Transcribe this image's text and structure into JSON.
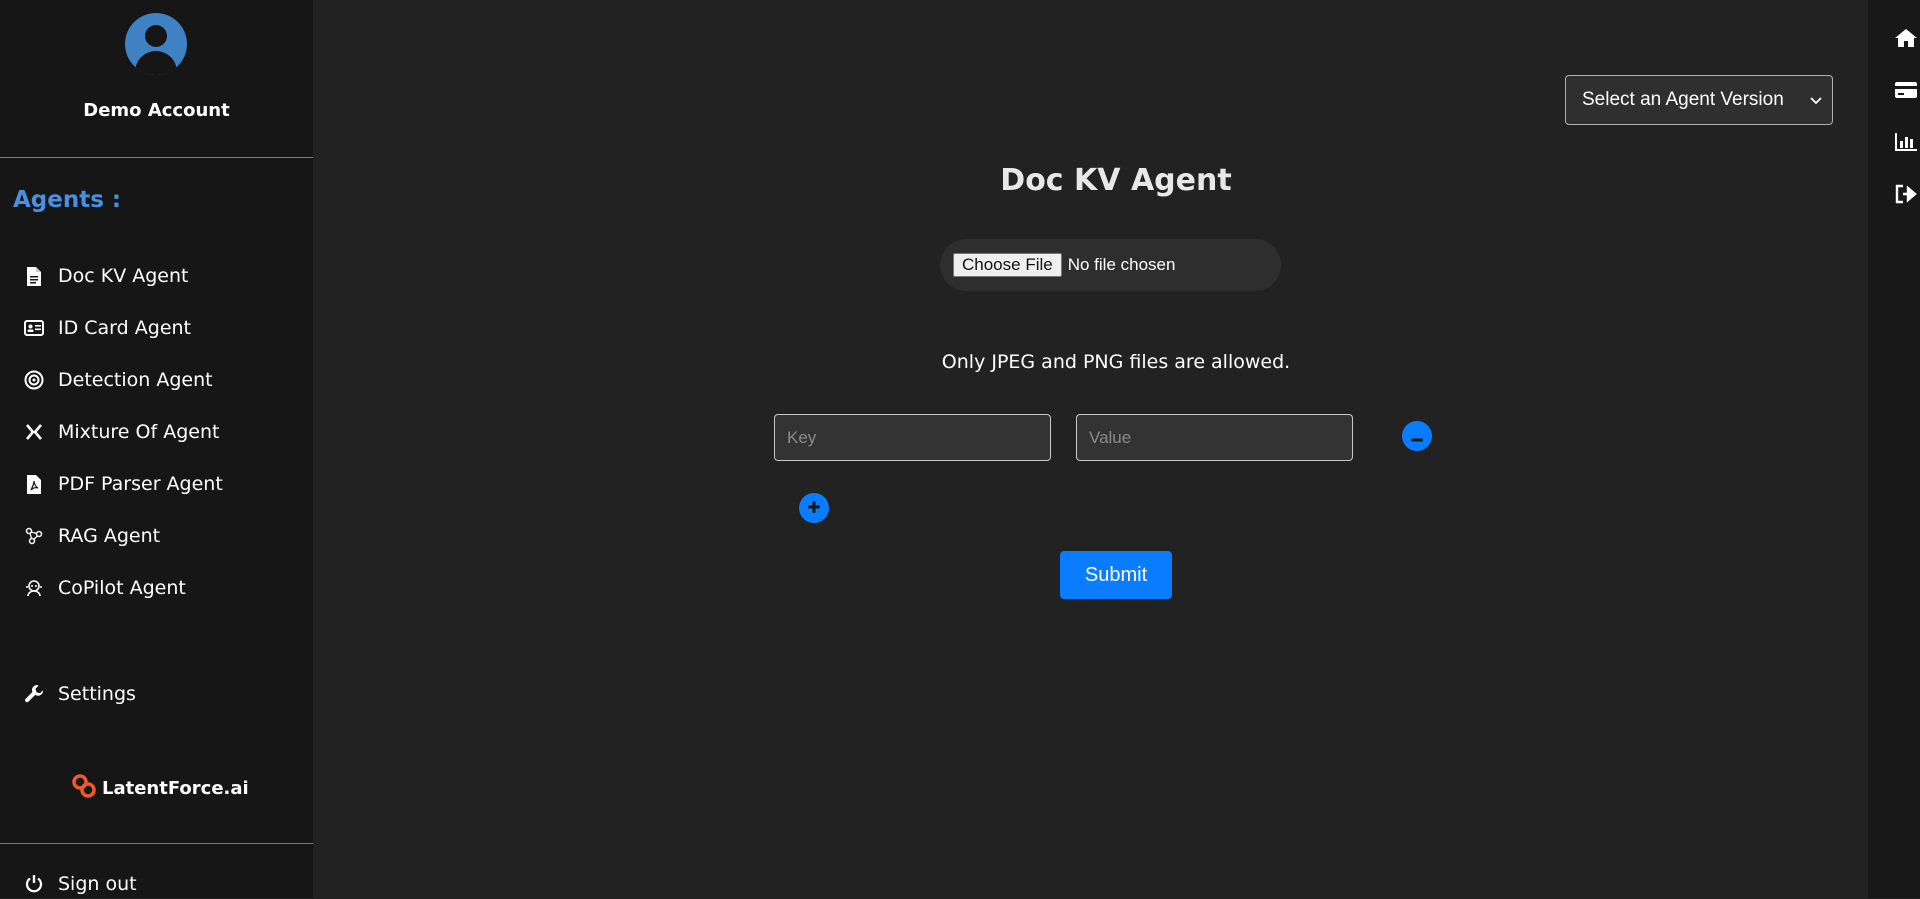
{
  "sidebar": {
    "account_name": "Demo Account",
    "agents_heading": "Agents :",
    "items": [
      {
        "label": "Doc KV Agent",
        "icon": "document-icon"
      },
      {
        "label": "ID Card Agent",
        "icon": "id-card-icon"
      },
      {
        "label": "Detection Agent",
        "icon": "target-icon"
      },
      {
        "label": "Mixture Of Agent",
        "icon": "cross-arrows-icon"
      },
      {
        "label": "PDF Parser Agent",
        "icon": "pdf-file-icon"
      },
      {
        "label": "RAG Agent",
        "icon": "network-nodes-icon"
      },
      {
        "label": "CoPilot Agent",
        "icon": "robot-icon"
      }
    ],
    "settings_label": "Settings",
    "logo_text": "LatentForce.ai",
    "signout_label": "Sign out"
  },
  "header": {
    "version_select": "Select an Agent Version"
  },
  "main": {
    "title": "Doc KV Agent",
    "file_button": "Choose File",
    "file_status": "No file chosen",
    "file_note": "Only JPEG and PNG files are allowed.",
    "key_placeholder": "Key",
    "value_placeholder": "Value",
    "submit_label": "Submit"
  },
  "rightbar": {
    "icons": [
      "home-icon",
      "credit-card-icon",
      "bar-chart-icon",
      "logout-icon"
    ]
  },
  "colors": {
    "accent": "#0a7cff",
    "agents_heading": "#4a90e2",
    "logo_orange": "#f05a28",
    "background": "#222222",
    "sidebar": "#161616"
  }
}
